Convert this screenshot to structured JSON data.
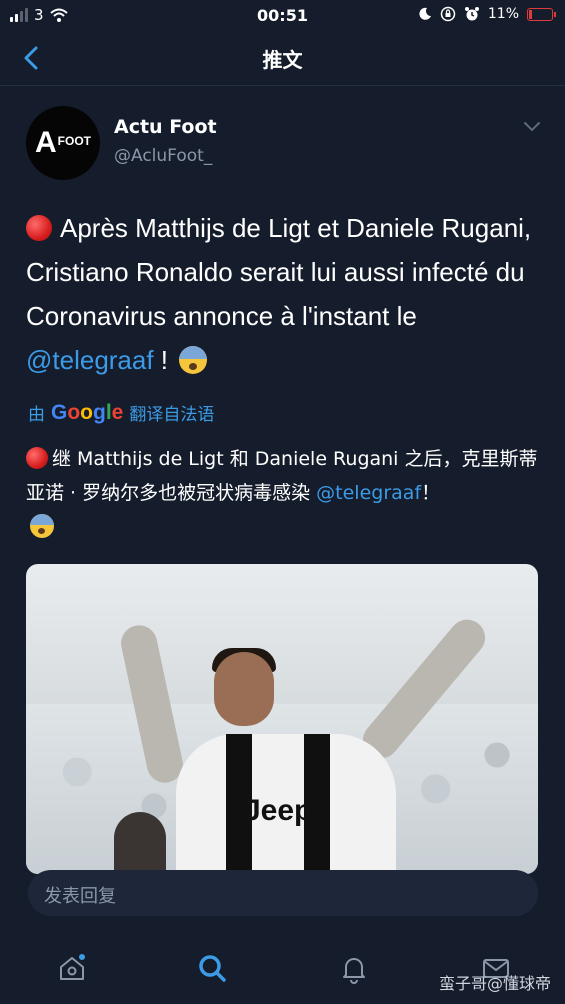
{
  "status_bar": {
    "carrier": "3",
    "time": "00:51",
    "battery": "11%"
  },
  "nav": {
    "title": "推文"
  },
  "tweet": {
    "display_name": "Actu Foot",
    "handle": "@AcluFoot_",
    "avatar": {
      "big": "A",
      "small": "FOOT"
    },
    "text_before_mention": "Après Matthijs de Ligt et Daniele Rugani, Cristiano Ronaldo serait lui aussi infecté du Coronavirus annonce à l'instant le",
    "mention": "@telegraaf",
    "text_after_mention": " !",
    "translation_prefix": "由",
    "translation_suffix": "翻译自法语",
    "translated_before_mention": "继 Matthijs de Ligt 和 Daniele Rugani 之后，克里斯蒂亚诺 · 罗纳尔多也被冠状病毒感染",
    "translated_mention": "@telegraaf",
    "translated_after_mention": "！",
    "media": {
      "jersey_text": "Jeep"
    }
  },
  "google_logo": [
    "G",
    "o",
    "o",
    "g",
    "l",
    "e"
  ],
  "reply": {
    "placeholder": "发表回复"
  },
  "tabs": [
    "home",
    "search",
    "notifications",
    "messages"
  ],
  "watermark": "蛮子哥@懂球帝",
  "colors": {
    "background": "#151c2b",
    "accent": "#3c9be6",
    "secondary_text": "#8a97a8"
  }
}
